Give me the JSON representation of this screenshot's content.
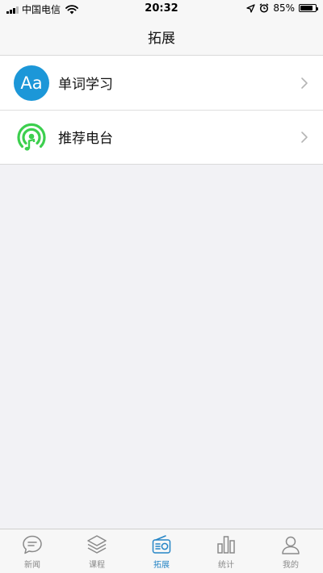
{
  "status_bar": {
    "carrier": "中国电信",
    "time": "20:32",
    "battery_percent": "85%",
    "battery_level": 0.85,
    "icons": [
      "signal-icon",
      "wifi-icon",
      "location-arrow-icon",
      "alarm-icon",
      "battery-icon"
    ]
  },
  "nav": {
    "title": "拓展"
  },
  "list": {
    "items": [
      {
        "label": "单词学习",
        "icon": "aa-icon",
        "icon_text": "Aa",
        "icon_color": "#1c97d8"
      },
      {
        "label": "推荐电台",
        "icon": "radio-music-icon",
        "icon_color": "#3ccf4e"
      }
    ]
  },
  "tab_bar": {
    "active_color": "#2585c6",
    "inactive_color": "#8a8a8a",
    "tabs": [
      {
        "label": "新闻",
        "icon": "chat-bubble-icon",
        "active": false
      },
      {
        "label": "课程",
        "icon": "layers-icon",
        "active": false
      },
      {
        "label": "拓展",
        "icon": "radio-icon",
        "active": true
      },
      {
        "label": "统计",
        "icon": "bar-chart-icon",
        "active": false
      },
      {
        "label": "我的",
        "icon": "person-icon",
        "active": false
      }
    ]
  }
}
